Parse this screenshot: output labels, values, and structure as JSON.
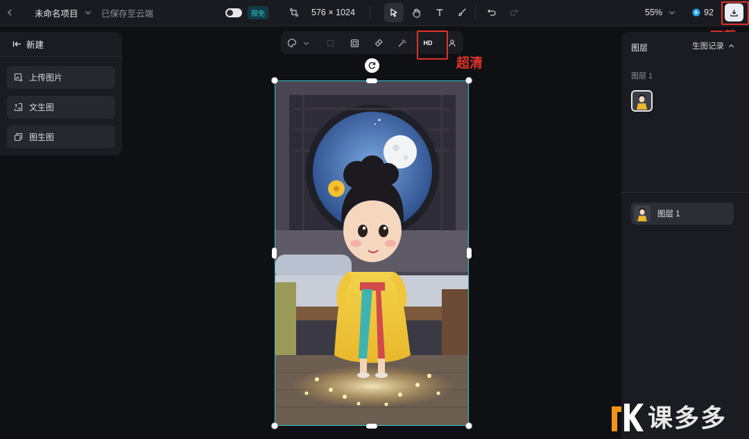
{
  "topbar": {
    "project_name": "未命名项目",
    "save_status": "已保存至云端",
    "limited_free_badge": "限免",
    "canvas_size": "576 × 1024",
    "zoom": "55%",
    "credits": "92"
  },
  "left_panel": {
    "new_label": "新建",
    "items": [
      {
        "label": "上传图片",
        "icon": "upload-image-icon"
      },
      {
        "label": "文生图",
        "icon": "text-to-image-icon"
      },
      {
        "label": "图生图",
        "icon": "image-to-image-icon"
      }
    ]
  },
  "float_toolbar": {
    "hd_label": "HD"
  },
  "annotations": {
    "download_label": "下载",
    "hd_label": "超清"
  },
  "right_panel": {
    "title": "图层",
    "history_label": "生图记录",
    "group_label": "图层 1",
    "layer_label": "图层 1"
  },
  "watermark": {
    "text": "课多多"
  },
  "colors": {
    "accent_cyan": "#2fc7cf",
    "annotation_red": "#e1322b",
    "panel_bg": "#1b1c21",
    "page_bg": "#0f1014"
  }
}
